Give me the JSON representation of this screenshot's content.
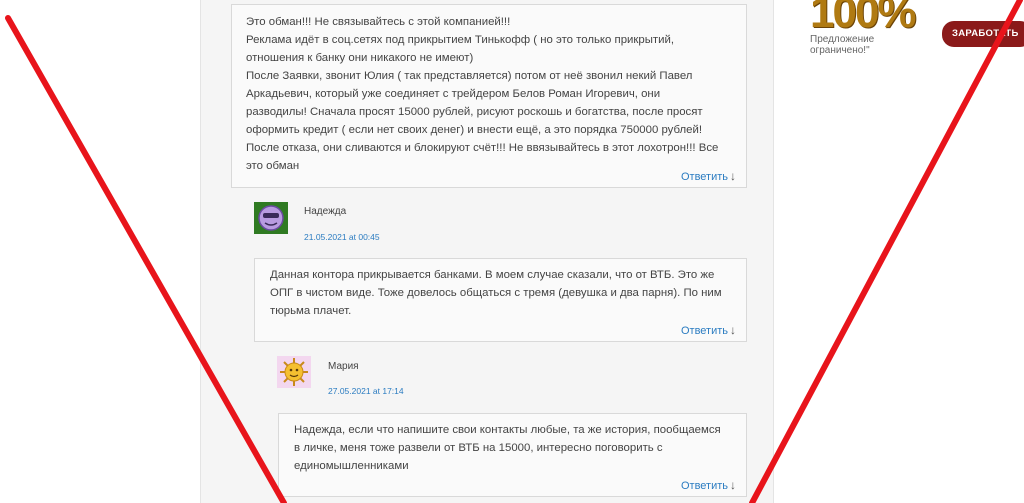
{
  "comments": [
    {
      "text": "Это обман!!! Не связывайтесь с этой компанией!!!\nРеклама идёт в соц.сетях под прикрытием Тинькофф ( но это только прикрытий,\nотношения к банку они никакого не имеют)\nПосле Заявки, звонит Юлия ( так представляется) потом от неё звонил некий Павел\nАркадьевич, который уже соединяет с трейдером Белов Роман Игоревич, они\nразводилы! Сначала просят 15000 рублей, рисуют роскошь и богатства, после просят\nоформить кредит ( если нет своих денег) и внести ещё, а это порядка 750000 рублей!\nПосле отказа, они сливаются и блокируют счёт!!! Не ввязывайтесь в этот лохотрон!!! Все\nэто обман",
      "reply": "Ответить"
    },
    {
      "author": "Надежда",
      "date": "21.05.2021 at 00:45",
      "text": "Данная контора прикрывается банками. В моем случае сказали, что от ВТБ. Это же\nОПГ в чистом виде. Тоже довелось общаться с тремя (девушка и два парня). По ним\nтюрьма плачет.",
      "reply": "Ответить"
    },
    {
      "author": "Мария",
      "date": "27.05.2021 at 17:14",
      "text": "Надежда, если что напишите свои контакты любые, та же история, пообщаемся\nв личке, меня тоже развели от ВТБ на 15000, интересно поговорить с\nединомышленниками",
      "reply": "Ответить"
    }
  ],
  "reply_arrow": "↓",
  "ad": {
    "big_text": "100%",
    "caption_line1": "Предложение",
    "caption_line2": "ограничено!\"",
    "button": "ЗАРАБОТАТЬ"
  },
  "colors": {
    "link": "#2b7cc1",
    "cross": "#e8141b",
    "ad_button": "#8b1a1a"
  },
  "icons": {
    "avatar_nadezhda": "purple-face-avatar",
    "avatar_maria": "sun-face-avatar"
  }
}
